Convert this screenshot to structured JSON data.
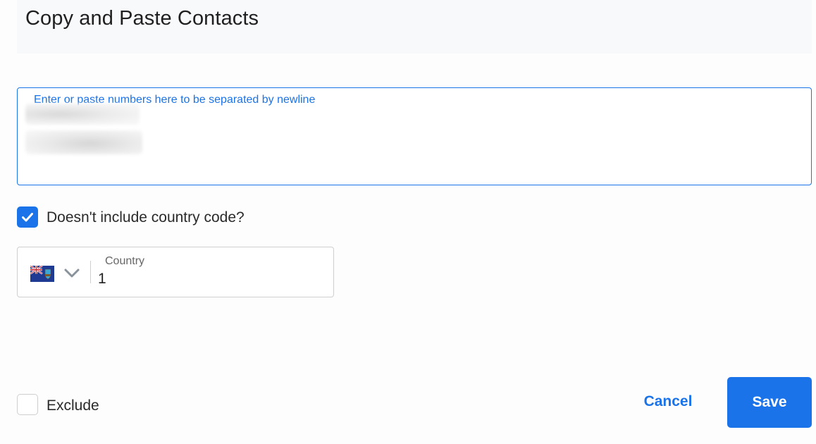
{
  "dialog": {
    "title": "Copy and Paste Contacts"
  },
  "numbers_input": {
    "label": "Enter or paste numbers here to be separated by newline",
    "value": ""
  },
  "country_code_toggle": {
    "label": "Doesn't include country code?",
    "checked": true
  },
  "country_field": {
    "label": "Country",
    "value": "1",
    "flag_icon": "montserrat-flag-icon"
  },
  "exclude_toggle": {
    "label": "Exclude",
    "checked": false
  },
  "actions": {
    "cancel_label": "Cancel",
    "save_label": "Save"
  },
  "colors": {
    "accent": "#1a73e8",
    "border": "#cfcfcf",
    "header_bg": "#f8f9fb"
  }
}
